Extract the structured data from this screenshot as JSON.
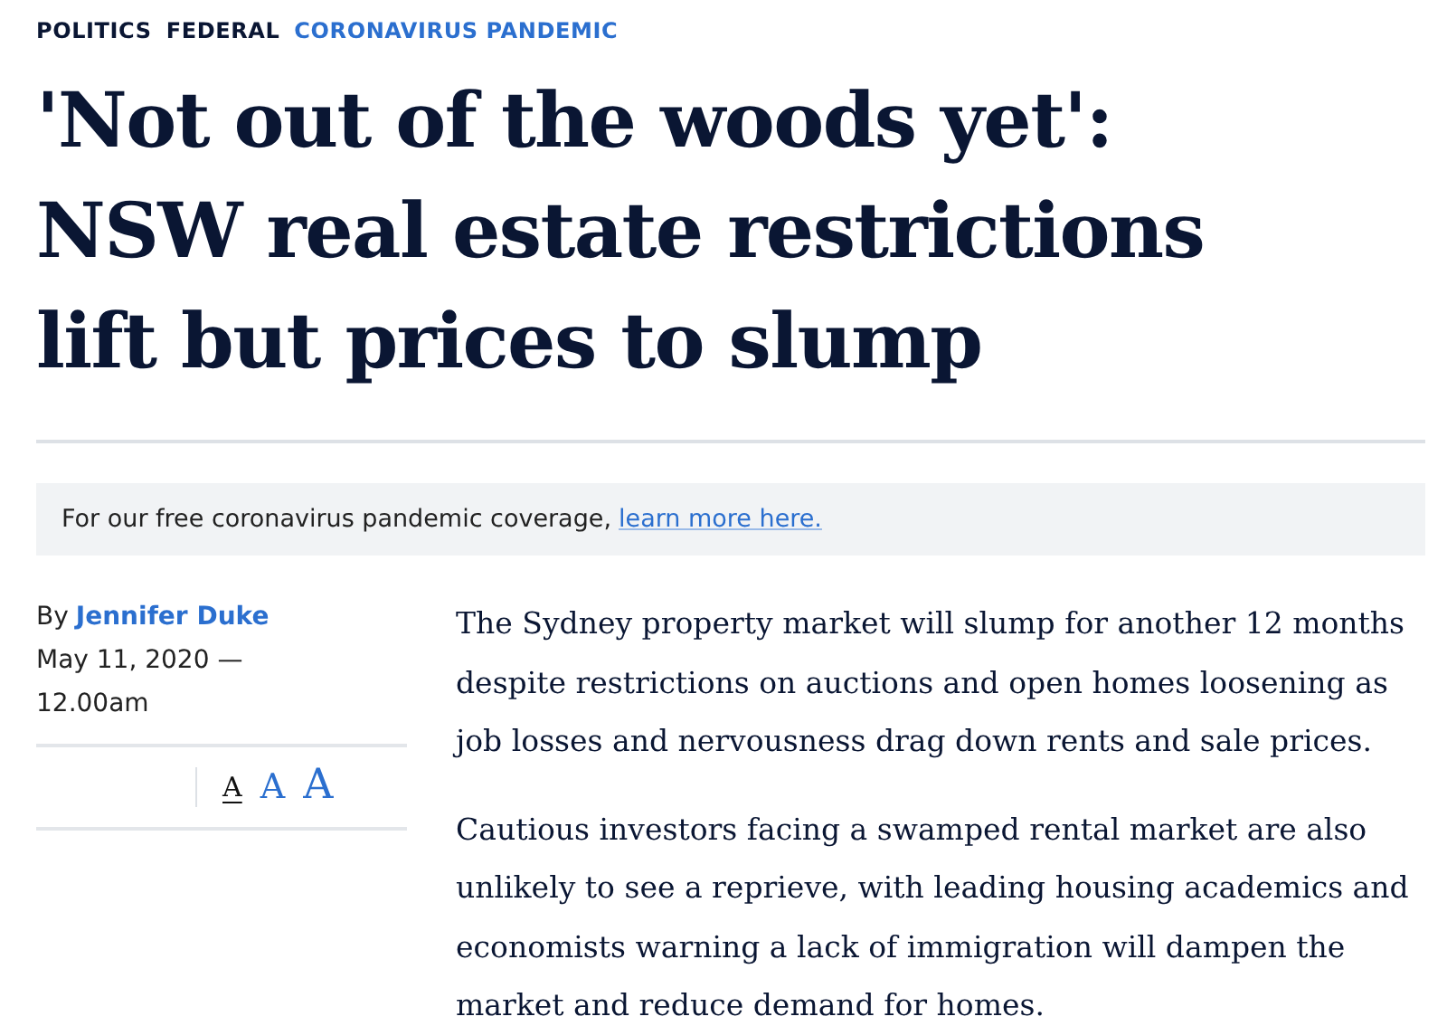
{
  "breadcrumbs": [
    {
      "label": "POLITICS",
      "color": "#0a1633"
    },
    {
      "label": "FEDERAL",
      "color": "#0a1633"
    },
    {
      "label": "CORONAVIRUS PANDEMIC",
      "color": "#2b6fcf"
    }
  ],
  "headline": "'Not out of the woods yet': NSW real estate restrictions lift but prices to slump",
  "notice": {
    "text": "For our free coronavirus pandemic coverage,",
    "link": "learn more here."
  },
  "byline": {
    "prefix": "By",
    "author": "Jennifer Duke",
    "date": "May 11, 2020 —",
    "time": "12.00am"
  },
  "font_sizes": [
    {
      "label": "A",
      "kind": "small",
      "selected": true
    },
    {
      "label": "A",
      "kind": "medium",
      "selected": false
    },
    {
      "label": "A",
      "kind": "large",
      "selected": false
    }
  ],
  "paragraphs": [
    "The Sydney property market will slump for another 12 months despite restrictions on auctions and open homes loosening as job losses and nervousness drag down rents and sale prices.",
    "Cautious investors facing a swamped rental market are also unlikely to see a reprieve, with leading housing academics and economists warning a lack of immigration will dampen the market and reduce demand for homes."
  ]
}
